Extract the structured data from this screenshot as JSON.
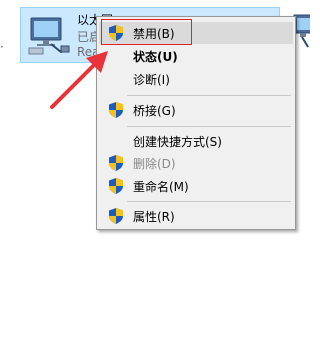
{
  "adapter": {
    "name": "以太网",
    "status": "已启",
    "device": "Rea"
  },
  "menu": {
    "items": [
      {
        "label": "禁用(B)",
        "icon": "shield-icon",
        "highlighted": true
      },
      {
        "label": "状态(U)",
        "bold": true
      },
      {
        "label": "诊断(I)"
      },
      {
        "label": "桥接(G)",
        "icon": "shield-icon"
      },
      {
        "label": "创建快捷方式(S)"
      },
      {
        "label": "删除(D)",
        "icon": "shield-icon",
        "disabled": true
      },
      {
        "label": "重命名(M)",
        "icon": "shield-icon"
      },
      {
        "label": "属性(R)",
        "icon": "shield-icon"
      }
    ]
  },
  "colors": {
    "highlight_box": "#e0232a",
    "arrow": "#e8333a",
    "selection": "#cce8ff"
  }
}
